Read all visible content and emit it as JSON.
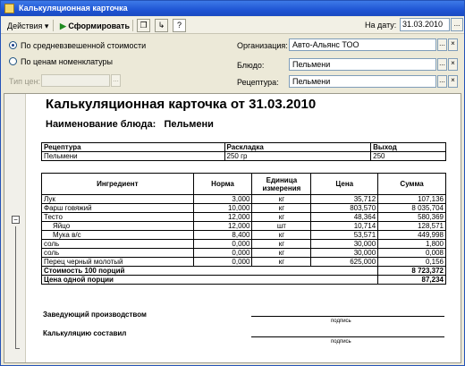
{
  "window": {
    "title": "Калькуляционная карточка"
  },
  "toolbar": {
    "actions_label": "Действия ▾",
    "generate_label": "Сформировать",
    "help_label": "?",
    "date_label": "На дату:",
    "date_value": "31.03.2010",
    "date_button": "..."
  },
  "options": {
    "radio_weighted": "По средневзвешенной стоимости",
    "radio_prices": "По ценам номенклатуры",
    "price_type_label": "Тип цен:",
    "price_type_value": ""
  },
  "filters": {
    "org_label": "Организация:",
    "org_value": "Авто-Альянс ТОО",
    "dish_label": "Блюдо:",
    "dish_value": "Пельмени",
    "recipe_label": "Рецептура:",
    "recipe_value": "Пельмени",
    "select_button": "...",
    "clear_button": "×"
  },
  "report": {
    "title": "Калькуляционная карточка от 31.03.2010",
    "dish_heading": "Наименование блюда:",
    "dish_name": "Пельмени",
    "recipe_table": {
      "headers": [
        "Рецептура",
        "Раскладка",
        "Выход"
      ],
      "row": [
        "Пельмени",
        "250 гр",
        "250"
      ]
    },
    "ingredients_table": {
      "headers": [
        "Ингредиент",
        "Норма",
        "Единица измерения",
        "Цена",
        "Сумма"
      ],
      "rows": [
        {
          "name": "Лук",
          "norm": "3,000",
          "unit": "кг",
          "price": "35,712",
          "sum": "107,136"
        },
        {
          "name": "Фарш говяжий",
          "norm": "10,000",
          "unit": "кг",
          "price": "803,570",
          "sum": "8 035,704"
        },
        {
          "name": "Тесто",
          "norm": "12,000",
          "unit": "кг",
          "price": "48,364",
          "sum": "580,369"
        },
        {
          "name": "Яйцо",
          "norm": "12,000",
          "unit": "шт",
          "price": "10,714",
          "sum": "128,571"
        },
        {
          "name": "Мука в/с",
          "norm": "8,400",
          "unit": "кг",
          "price": "53,571",
          "sum": "449,998"
        },
        {
          "name": "соль",
          "norm": "0,000",
          "unit": "кг",
          "price": "30,000",
          "sum": "1,800"
        },
        {
          "name": "соль",
          "norm": "0,000",
          "unit": "кг",
          "price": "30,000",
          "sum": "0,008"
        },
        {
          "name": "Перец черный молотый",
          "norm": "0,000",
          "unit": "кг",
          "price": "625,000",
          "sum": "0,156"
        }
      ],
      "total_100_label": "Стоимость 100 порций",
      "total_100_value": "8 723,372",
      "portion_label": "Цена одной порции",
      "portion_value": "87,234"
    },
    "signature_1": "Заведующий производством",
    "signature_2": "Калькуляцию составил",
    "signature_caption": "подпись"
  }
}
